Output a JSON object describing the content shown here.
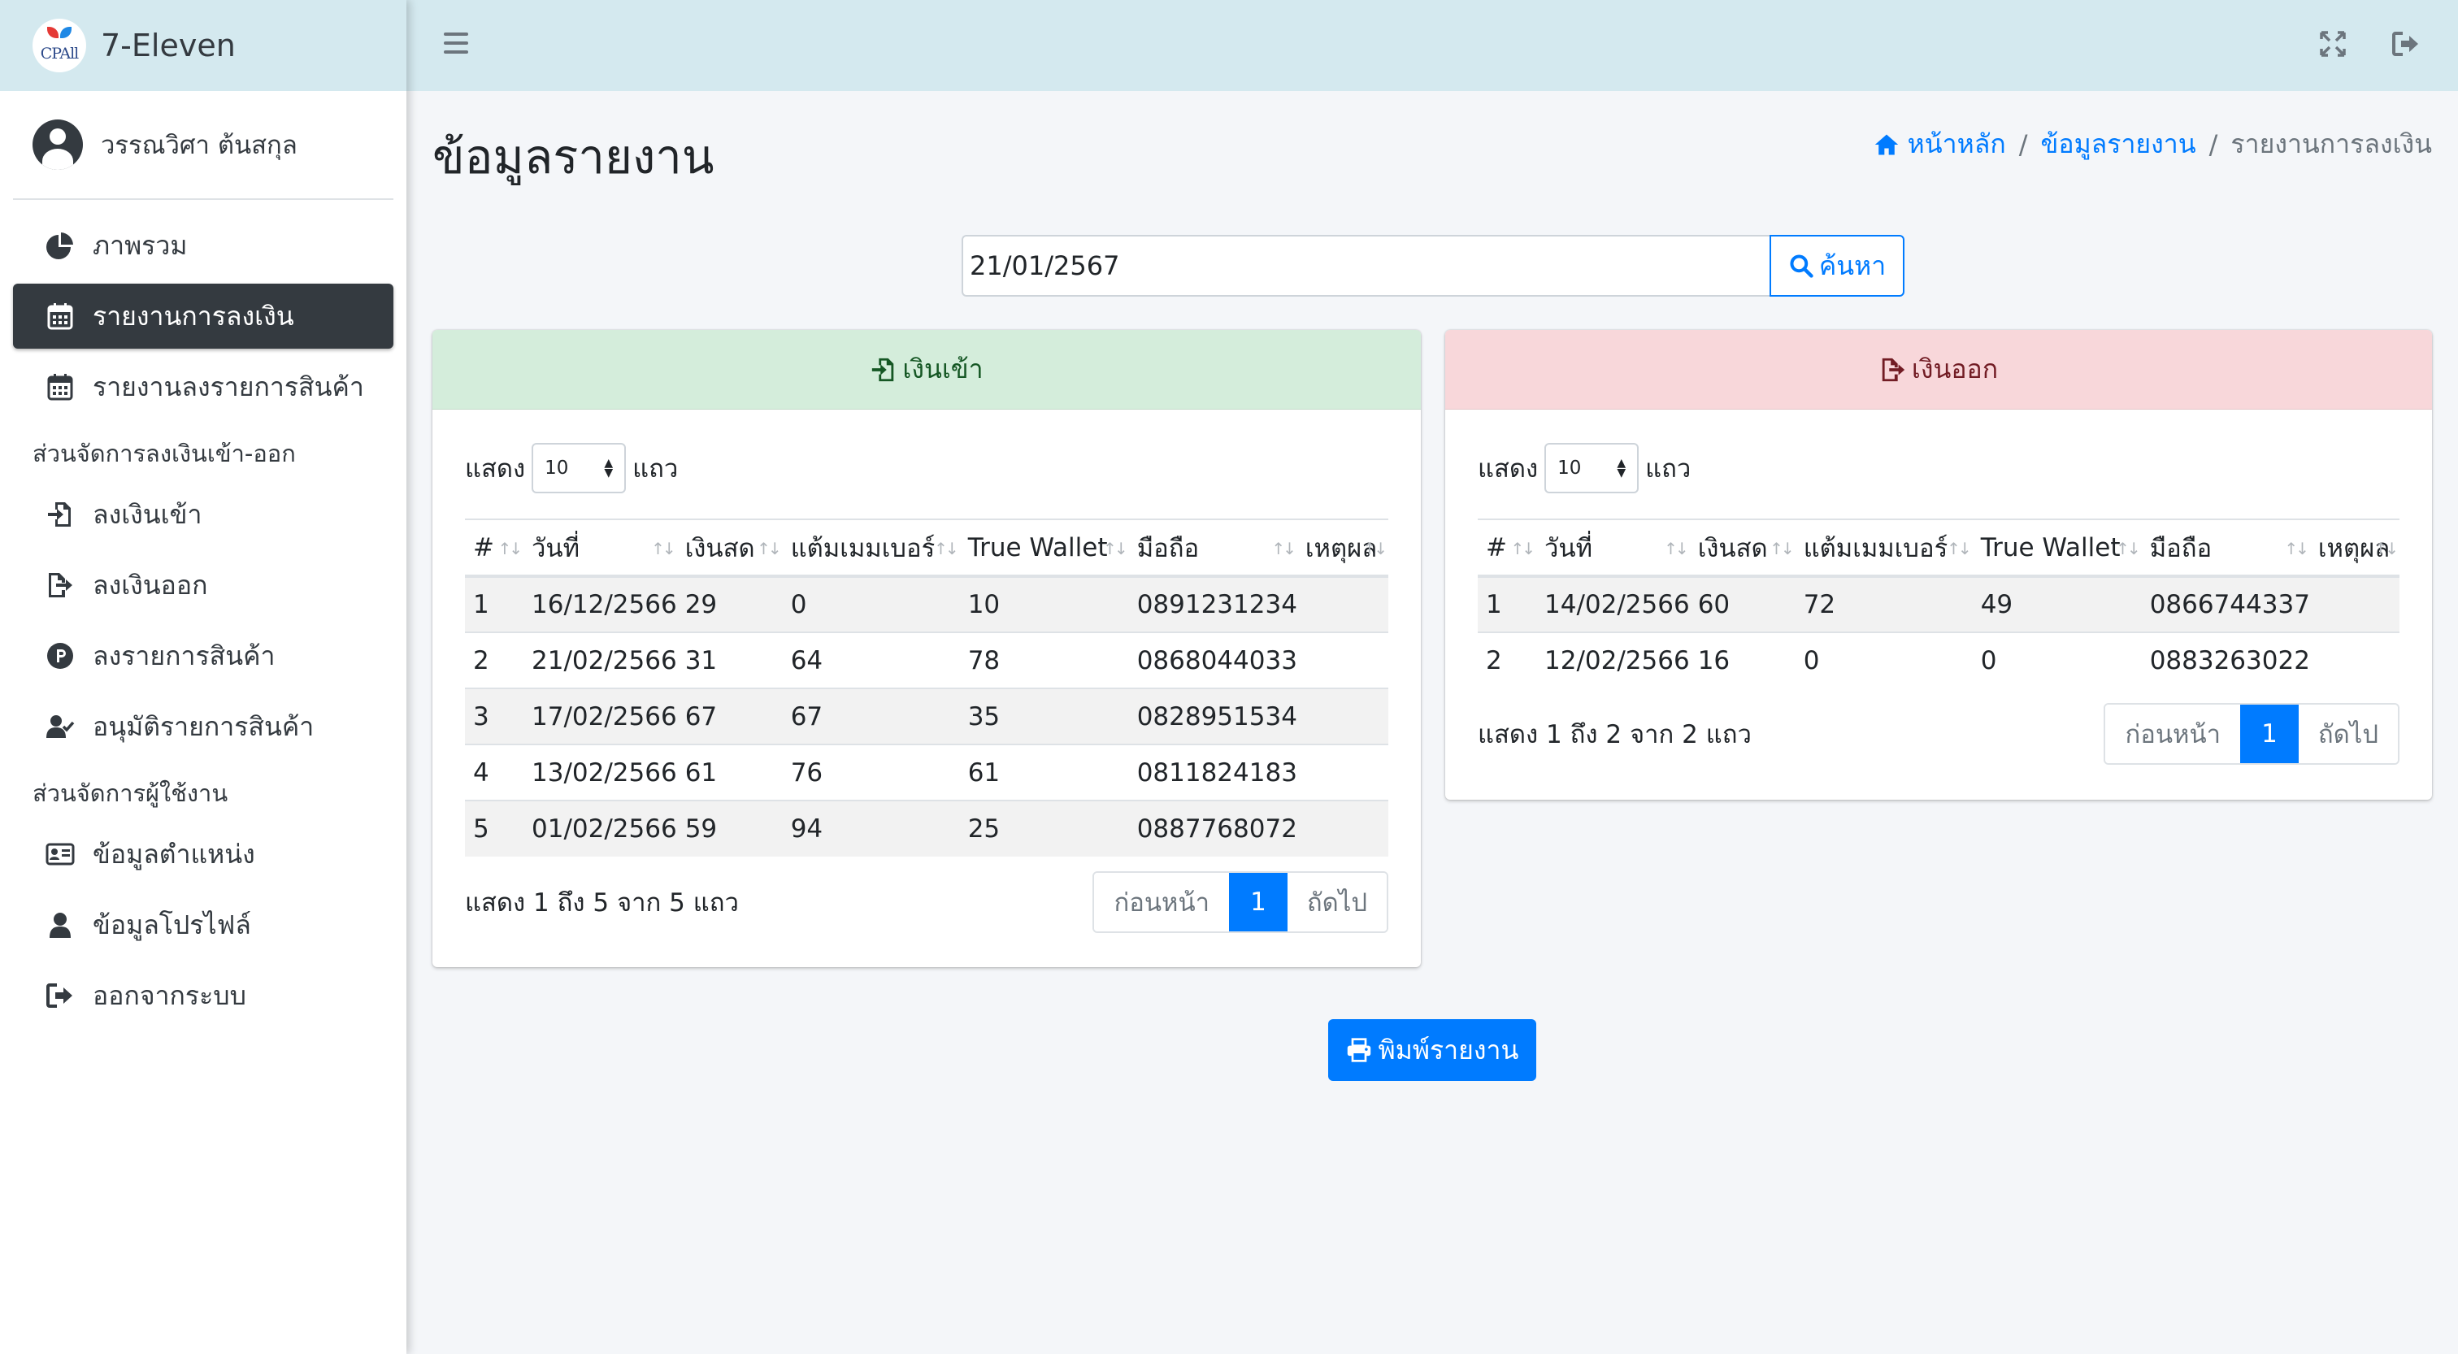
{
  "brand": {
    "logo_text": "CPAll",
    "name": "7-Eleven"
  },
  "user": {
    "name": "วรรณวิศา ต้นสกุล"
  },
  "sidebar": {
    "items": [
      {
        "label": "ภาพรวม",
        "icon": "pie-chart-icon",
        "active": false
      },
      {
        "label": "รายงานการลงเงิน",
        "icon": "calendar-icon",
        "active": true
      },
      {
        "label": "รายงานลงรายการสินค้า",
        "icon": "calendar-icon",
        "active": false
      }
    ],
    "section_money": "ส่วนจัดการลงเงินเข้า-ออก",
    "money_items": [
      {
        "label": "ลงเงินเข้า",
        "icon": "file-import-icon"
      },
      {
        "label": "ลงเงินออก",
        "icon": "file-export-icon"
      },
      {
        "label": "ลงรายการสินค้า",
        "icon": "product-circle-icon"
      },
      {
        "label": "อนุมัติรายการสินค้า",
        "icon": "user-check-icon"
      }
    ],
    "section_user": "ส่วนจัดการผู้ใช้งาน",
    "user_items": [
      {
        "label": "ข้อมูลตำแหน่ง",
        "icon": "id-card-icon"
      },
      {
        "label": "ข้อมูลโปรไฟล์",
        "icon": "user-icon"
      },
      {
        "label": "ออกจากระบบ",
        "icon": "sign-out-icon"
      }
    ]
  },
  "page": {
    "title": "ข้อมูลรายงาน",
    "breadcrumb": {
      "home": "หน้าหลัก",
      "section": "ข้อมูลรายงาน",
      "current": "รายงานการลงเงิน",
      "separator": "/"
    }
  },
  "search": {
    "value": "21/01/2567",
    "button_label": "ค้นหา"
  },
  "common": {
    "show_label": "แสดง",
    "rows_label": "แถว",
    "page_length": "10",
    "prev_label": "ก่อนหน้า",
    "next_label": "ถัดไป",
    "current_page": "1",
    "columns": [
      "#",
      "วันที่",
      "เงินสด",
      "แต้มเมมเบอร์",
      "True Wallet",
      "มือถือ",
      "เหตุผล"
    ]
  },
  "income": {
    "title": "เงินเข้า",
    "color": "#155724",
    "info": "แสดง 1 ถึง 5 จาก 5 แถว",
    "rows": [
      [
        "1",
        "16/12/2566",
        "29",
        "0",
        "10",
        "0891231234",
        ""
      ],
      [
        "2",
        "21/02/2566",
        "31",
        "64",
        "78",
        "0868044033",
        ""
      ],
      [
        "3",
        "17/02/2566",
        "67",
        "67",
        "35",
        "0828951534",
        ""
      ],
      [
        "4",
        "13/02/2566",
        "61",
        "76",
        "61",
        "0811824183",
        ""
      ],
      [
        "5",
        "01/02/2566",
        "59",
        "94",
        "25",
        "0887768072",
        ""
      ]
    ]
  },
  "expense": {
    "title": "เงินออก",
    "color": "#721c24",
    "info": "แสดง 1 ถึง 2 จาก 2 แถว",
    "rows": [
      [
        "1",
        "14/02/2566",
        "60",
        "72",
        "49",
        "0866744337",
        ""
      ],
      [
        "2",
        "12/02/2566",
        "16",
        "0",
        "0",
        "0883263022",
        ""
      ]
    ]
  },
  "print_label": "พิมพ์รายงาน",
  "colors": {
    "accent": "#007bff",
    "topbar": "#d4e9ef",
    "active_nav": "#343a40"
  }
}
